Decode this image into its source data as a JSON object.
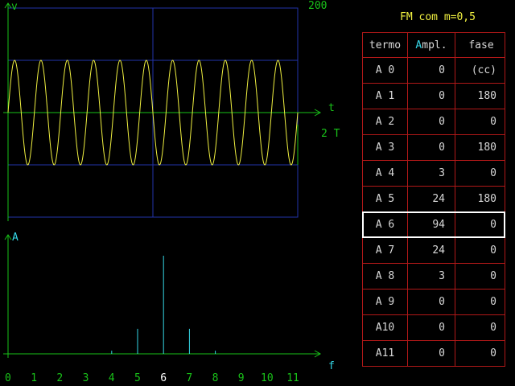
{
  "colors": {
    "axis": "#19c219",
    "grid": "#2233aa",
    "wave": "#f0f040",
    "spectrum": "#35d6e6",
    "table_border": "#b01818",
    "selected": "#ffffff"
  },
  "oscilloscope": {
    "v_label": "v",
    "t_label": "t",
    "scale_label": "200",
    "period_label": "2 T",
    "cycles": 11
  },
  "spectrum": {
    "a_label": "A",
    "f_label": "f",
    "selected_index": 6
  },
  "table": {
    "title": "FM com m=0,5",
    "headers": [
      "termo",
      "Ampl.",
      "fase"
    ],
    "rows": [
      {
        "term": "A 0",
        "ampl": "0",
        "fase": "(cc)"
      },
      {
        "term": "A 1",
        "ampl": "0",
        "fase": "180"
      },
      {
        "term": "A 2",
        "ampl": "0",
        "fase": "0"
      },
      {
        "term": "A 3",
        "ampl": "0",
        "fase": "180"
      },
      {
        "term": "A 4",
        "ampl": "3",
        "fase": "0"
      },
      {
        "term": "A 5",
        "ampl": "24",
        "fase": "180"
      },
      {
        "term": "A 6",
        "ampl": "94",
        "fase": "0"
      },
      {
        "term": "A 7",
        "ampl": "24",
        "fase": "0"
      },
      {
        "term": "A 8",
        "ampl": "3",
        "fase": "0"
      },
      {
        "term": "A 9",
        "ampl": "0",
        "fase": "0"
      },
      {
        "term": "A10",
        "ampl": "0",
        "fase": "0"
      },
      {
        "term": "A11",
        "ampl": "0",
        "fase": "0"
      }
    ]
  },
  "chart_data": {
    "type": "bar",
    "categories": [
      "0",
      "1",
      "2",
      "3",
      "4",
      "5",
      "6",
      "7",
      "8",
      "9",
      "10",
      "11"
    ],
    "values": [
      0,
      0,
      0,
      0,
      3,
      24,
      94,
      24,
      3,
      0,
      0,
      0
    ],
    "ylim": [
      0,
      100
    ]
  }
}
